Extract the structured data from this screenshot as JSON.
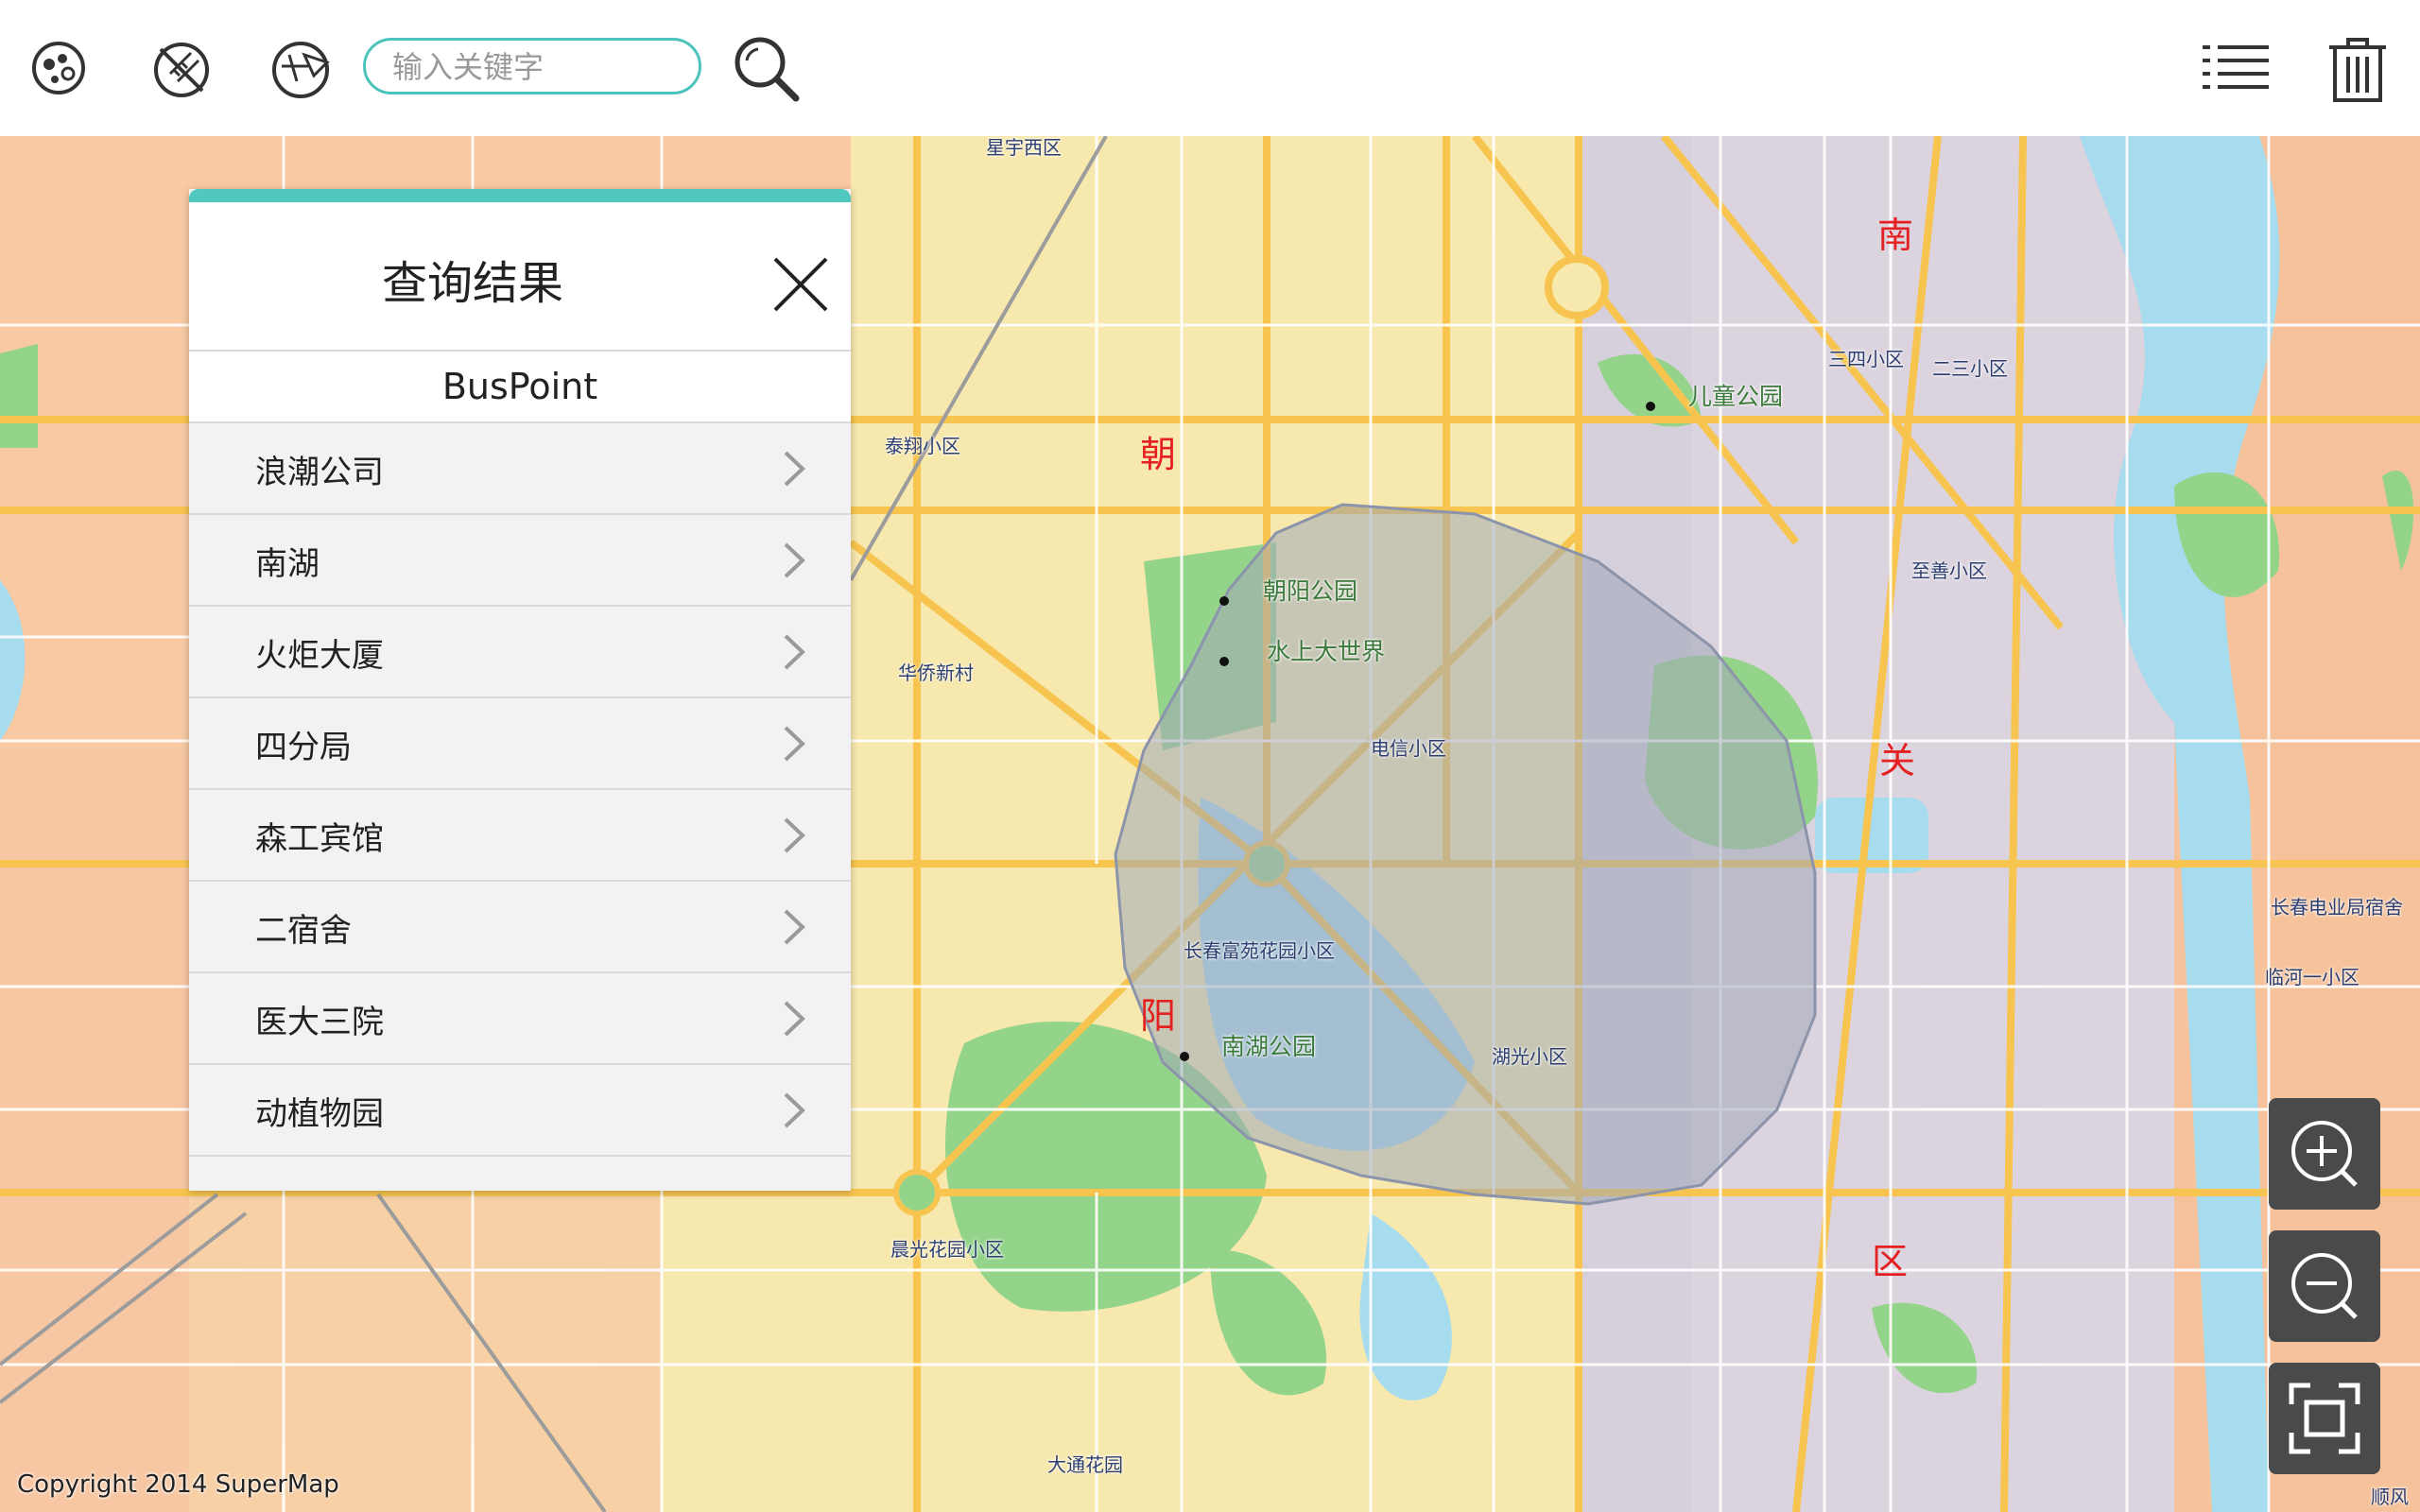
{
  "toolbar": {
    "icons": [
      "layers-icon",
      "clear-measure-icon",
      "query-icon",
      "search-icon",
      "list-icon",
      "trash-icon"
    ],
    "search_placeholder": "输入关键字"
  },
  "panel": {
    "title": "查询结果",
    "dataset": "BusPoint",
    "items": [
      "浪潮公司",
      "南湖",
      "火炬大厦",
      "四分局",
      "森工宾馆",
      "二宿舍",
      "医大三院",
      "动植物园"
    ]
  },
  "map": {
    "labels": {
      "l1": "星宇西区",
      "l2": "泰翔小区",
      "l3": "华侨新村",
      "l4": "朝阳公园",
      "l5": "水上大世界",
      "l6": "电信小区",
      "l7": "长春富苑花园小区",
      "l8": "南湖公园",
      "l9": "湖光小区",
      "l10": "晨光花园小区",
      "l11": "大通花园",
      "l12": "儿童公园",
      "l13": "三四小区",
      "l14": "二三小区",
      "l15": "至善小区",
      "l16": "长春电业局宿舍",
      "l17": "临河一小区",
      "l18": "顺风",
      "d1": "南",
      "d2": "朝",
      "d3": "关",
      "d4": "阳",
      "d5": "区"
    },
    "copyright": "Copyright 2014 SuperMap"
  },
  "controls": [
    "zoom-in-icon",
    "zoom-out-icon",
    "full-extent-icon"
  ],
  "colors": {
    "accent": "#50c8c0",
    "query_polygon": "#9aa6b8",
    "district_label": "#e52020"
  }
}
